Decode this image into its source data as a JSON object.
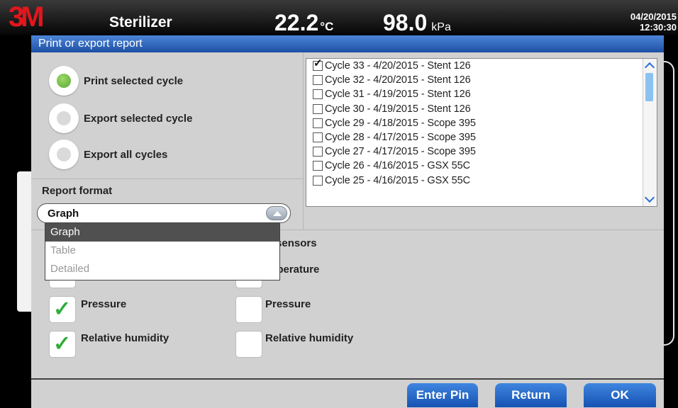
{
  "header": {
    "logo_text": "3M",
    "title": "Sterilizer",
    "temperature": "22.2",
    "temperature_unit": "°C",
    "pressure": "98.0",
    "pressure_unit": "kPa",
    "date": "04/20/2015",
    "time": "12:30:30"
  },
  "dialog": {
    "title": "Print or export report",
    "options": [
      {
        "label": "Print selected cycle",
        "selected": true
      },
      {
        "label": "Export selected cycle",
        "selected": false
      },
      {
        "label": "Export all cycles",
        "selected": false
      }
    ],
    "report_format": {
      "label": "Report format",
      "value": "Graph",
      "options": [
        "Graph",
        "Table",
        "Detailed"
      ]
    },
    "cycles": [
      {
        "label": "Cycle 33 - 4/20/2015 - Stent 126",
        "checked": true
      },
      {
        "label": "Cycle 32 - 4/20/2015 - Stent 126",
        "checked": false
      },
      {
        "label": "Cycle 31 - 4/19/2015 - Stent 126",
        "checked": false
      },
      {
        "label": "Cycle 30 - 4/19/2015 - Stent 126",
        "checked": false
      },
      {
        "label": "Cycle 29 - 4/18/2015 - Scope 395",
        "checked": false
      },
      {
        "label": "Cycle 28 - 4/17/2015 - Scope 395",
        "checked": false
      },
      {
        "label": "Cycle 27 - 4/17/2015 - Scope 395",
        "checked": false
      },
      {
        "label": "Cycle 26 - 4/16/2015 - GSX 55C",
        "checked": false
      },
      {
        "label": "Cycle 25 - 4/16/2015 - GSX 55C",
        "checked": false
      }
    ],
    "sensors_label_partial": "r sensors",
    "left_sensors": [
      {
        "label": "Pressure",
        "checked": true
      },
      {
        "label": "Relative humidity",
        "checked": true
      }
    ],
    "right_sensors": [
      {
        "label": "mperature",
        "checked": false
      },
      {
        "label": "Pressure",
        "checked": false
      },
      {
        "label": "Relative humidity",
        "checked": false
      }
    ],
    "buttons": {
      "enter_pin": "Enter Pin",
      "return": "Return",
      "ok": "OK"
    }
  },
  "colors": {
    "accent_blue": "#1d4fa4",
    "check_green": "#2fae3a",
    "radio_green": "#5aa832",
    "logo_red": "#e3161c"
  }
}
